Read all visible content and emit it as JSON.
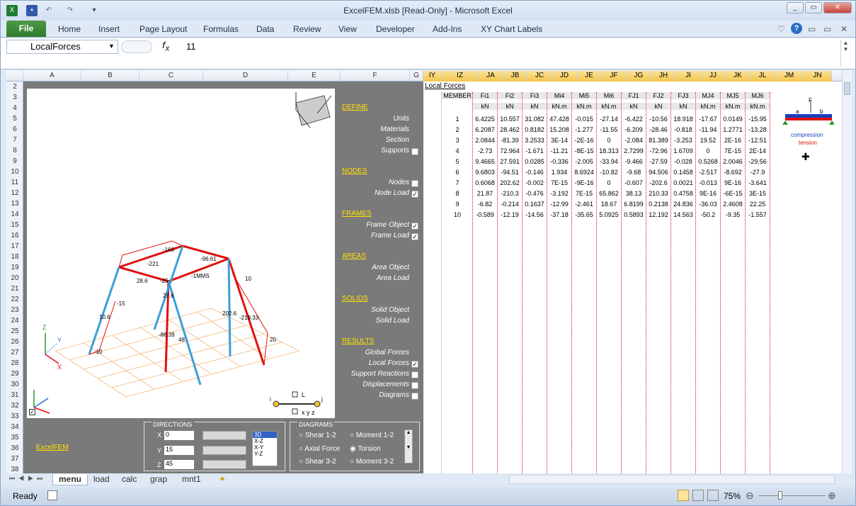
{
  "window": {
    "title": "ExcelFEM.xlsb  [Read-Only]  -  Microsoft Excel"
  },
  "ribbon": {
    "file": "File",
    "tabs": [
      "Home",
      "Insert",
      "Page Layout",
      "Formulas",
      "Data",
      "Review",
      "View",
      "Developer",
      "Add-Ins",
      "XY Chart Labels"
    ]
  },
  "formula": {
    "namebox": "LocalForces",
    "fx": "fx",
    "value": "11"
  },
  "columns_left": [
    "A",
    "B",
    "C",
    "D",
    "E",
    "F",
    "G"
  ],
  "columns_right": [
    "IY",
    "IZ",
    "JA",
    "JB",
    "JC",
    "JD",
    "JE",
    "JF",
    "JG",
    "JH",
    "JI",
    "JJ",
    "JK",
    "JL",
    "JM",
    "JN"
  ],
  "rows": [
    "2",
    "3",
    "4",
    "5",
    "6",
    "7",
    "8",
    "9",
    "10",
    "11",
    "12",
    "13",
    "14",
    "15",
    "16",
    "17",
    "18",
    "19",
    "20",
    "21",
    "22",
    "23",
    "24",
    "25",
    "26",
    "27",
    "28",
    "29",
    "30",
    "31",
    "32",
    "33",
    "34",
    "35",
    "36",
    "37",
    "38"
  ],
  "menu": {
    "define": "DEFINE",
    "units": "Units",
    "materials": "Materials",
    "section": "Section",
    "supports": "Supports",
    "nodes_h": "NODES",
    "nodes": "Nodes",
    "node_load": "Node Load",
    "frames_h": "FRAMES",
    "frame_object": "Frame Object",
    "frame_load": "Frame Load",
    "areas_h": "AREAS",
    "area_object": "Area Object",
    "area_load": "Area Load",
    "solids_h": "SOLIDS",
    "solid_object": "Solid Object",
    "solid_load": "Solid Load",
    "results_h": "RESULTS",
    "global_forces": "Global Forces",
    "local_forces": "Local Forces",
    "support_reactions": "Support Reactions",
    "displacements": "Displacements",
    "diagrams": "Diagrams",
    "excelfem": "ExcelFEM"
  },
  "directions": {
    "title": "DIRECTIONS",
    "x_label": "X",
    "y_label": "Y",
    "z_label": "Z",
    "x": "0",
    "y": "15",
    "z": "45",
    "views": [
      "3D",
      "X-Z",
      "X-Y",
      "Y-Z"
    ]
  },
  "diagrams_box": {
    "title": "DIAGRAMS",
    "shear12": "Shear 1-2",
    "moment12": "Moment 1-2",
    "axial": "Axial Force",
    "torsion": "Torsion",
    "shear32": "Shear 3-2",
    "moment32": "Moment 3-2"
  },
  "canvas_labels": {
    "l": "L",
    "xyz": "x y z",
    "i": "i",
    "j": "j",
    "axis_x": "X",
    "axis_y": "Y",
    "axis_z": "Z"
  },
  "table": {
    "title": "Local Forces",
    "member": "MEMBER",
    "headers": [
      "Fi1",
      "Fi2",
      "Fi3",
      "Mi4",
      "Mi5",
      "Mi6",
      "FJ1",
      "FJ2",
      "FJ3",
      "MJ4",
      "MJ5",
      "MJ6"
    ],
    "units": [
      "kN",
      "kN",
      "kN",
      "kN.m",
      "kN.m",
      "kN.m",
      "kN",
      "kN",
      "kN",
      "kN.m",
      "kN.m",
      "kN.m"
    ],
    "rows": [
      [
        "1",
        "6.4225",
        "10.557",
        "31.082",
        "47.428",
        "-0.015",
        "-27.14",
        "-6.422",
        "-10.56",
        "18.918",
        "-17.67",
        "0.0149",
        "-15.95"
      ],
      [
        "2",
        "6.2087",
        "28.462",
        "0.8182",
        "15.208",
        "-1.277",
        "-11.55",
        "-6.209",
        "-28.46",
        "-0.818",
        "-11.94",
        "1.2771",
        "-13.28"
      ],
      [
        "3",
        "2.0844",
        "-81.39",
        "3.2533",
        "3E-14",
        "-2E-16",
        "0",
        "-2.084",
        "81.389",
        "-3.253",
        "19.52",
        "2E-16",
        "-12.51"
      ],
      [
        "4",
        "-2.73",
        "72.964",
        "-1.671",
        "-11.21",
        "-8E-15",
        "18.313",
        "2.7299",
        "-72.96",
        "1.6709",
        "0",
        "7E-15",
        "2E-14"
      ],
      [
        "5",
        "9.4665",
        "27.591",
        "0.0285",
        "-0.336",
        "-2.005",
        "-33.94",
        "-9.466",
        "-27.59",
        "-0.028",
        "0.5268",
        "2.0046",
        "-29.56"
      ],
      [
        "6",
        "9.6803",
        "-94.51",
        "-0.146",
        "1.934",
        "8.6924",
        "-10.82",
        "-9.68",
        "94.506",
        "0.1458",
        "-2.517",
        "-8.692",
        "-27.9"
      ],
      [
        "7",
        "0.6068",
        "202.62",
        "-0.002",
        "7E-15",
        "-9E-16",
        "0",
        "-0.607",
        "-202.6",
        "0.0021",
        "-0.013",
        "9E-16",
        "-3.641"
      ],
      [
        "8",
        "21.87",
        "-210.3",
        "-0.476",
        "-3.192",
        "7E-15",
        "65.862",
        "38.13",
        "210.33",
        "0.4758",
        "9E-16",
        "-6E-15",
        "3E-15"
      ],
      [
        "9",
        "-6.82",
        "-0.214",
        "0.1637",
        "-12.99",
        "-2.461",
        "18.67",
        "6.8199",
        "0.2138",
        "24.836",
        "-36.03",
        "2.4608",
        "22.25"
      ],
      [
        "10",
        "-0.589",
        "-12.19",
        "-14.56",
        "-37.18",
        "-35.65",
        "5.0925",
        "0.5893",
        "12.192",
        "14.563",
        "-50.2",
        "-9.35",
        "-1.557"
      ]
    ]
  },
  "legend": {
    "f": "F",
    "a": "a",
    "b": "b",
    "compression": "compression",
    "tension": "tension"
  },
  "sheets": [
    "menu",
    "load",
    "calc",
    "grap",
    "mnt1"
  ],
  "status": {
    "ready": "Ready",
    "zoom": "75%"
  },
  "colors": {
    "accent": "#ffe100",
    "blue": "#3aa0d8",
    "red": "#e01010"
  }
}
